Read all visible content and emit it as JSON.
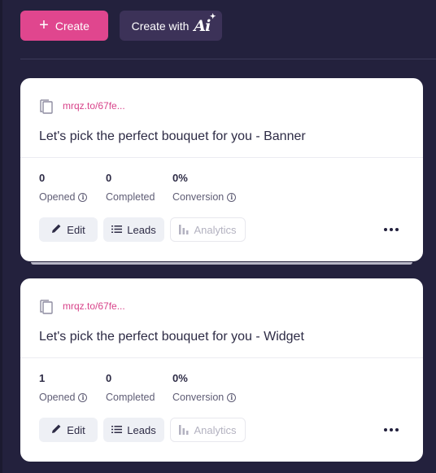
{
  "toolbar": {
    "create_label": "Create",
    "create_with_label": "Create with",
    "ai_label": "Ai"
  },
  "colors": {
    "background": "#23213d",
    "create_button": "#e0468e",
    "ai_button": "#3c3258",
    "link": "#d8438a"
  },
  "cards": [
    {
      "short_link": "mrqz.to/67fe...",
      "title": "Let's pick the perfect bouquet for you - Banner",
      "stats": {
        "opened_value": "0",
        "opened_label": "Opened",
        "completed_value": "0",
        "completed_label": "Completed",
        "conversion_value": "0%",
        "conversion_label": "Conversion"
      },
      "actions": {
        "edit": "Edit",
        "leads": "Leads",
        "analytics": "Analytics"
      }
    },
    {
      "short_link": "mrqz.to/67fe...",
      "title": "Let's pick the perfect bouquet for you - Widget",
      "stats": {
        "opened_value": "1",
        "opened_label": "Opened",
        "completed_value": "0",
        "completed_label": "Completed",
        "conversion_value": "0%",
        "conversion_label": "Conversion"
      },
      "actions": {
        "edit": "Edit",
        "leads": "Leads",
        "analytics": "Analytics"
      }
    }
  ],
  "icons": {
    "copy": "copy-icon",
    "info": "info-icon",
    "edit": "pencil-icon",
    "leads": "list-icon",
    "analytics": "bar-chart-icon",
    "more": "more-dots-icon"
  }
}
